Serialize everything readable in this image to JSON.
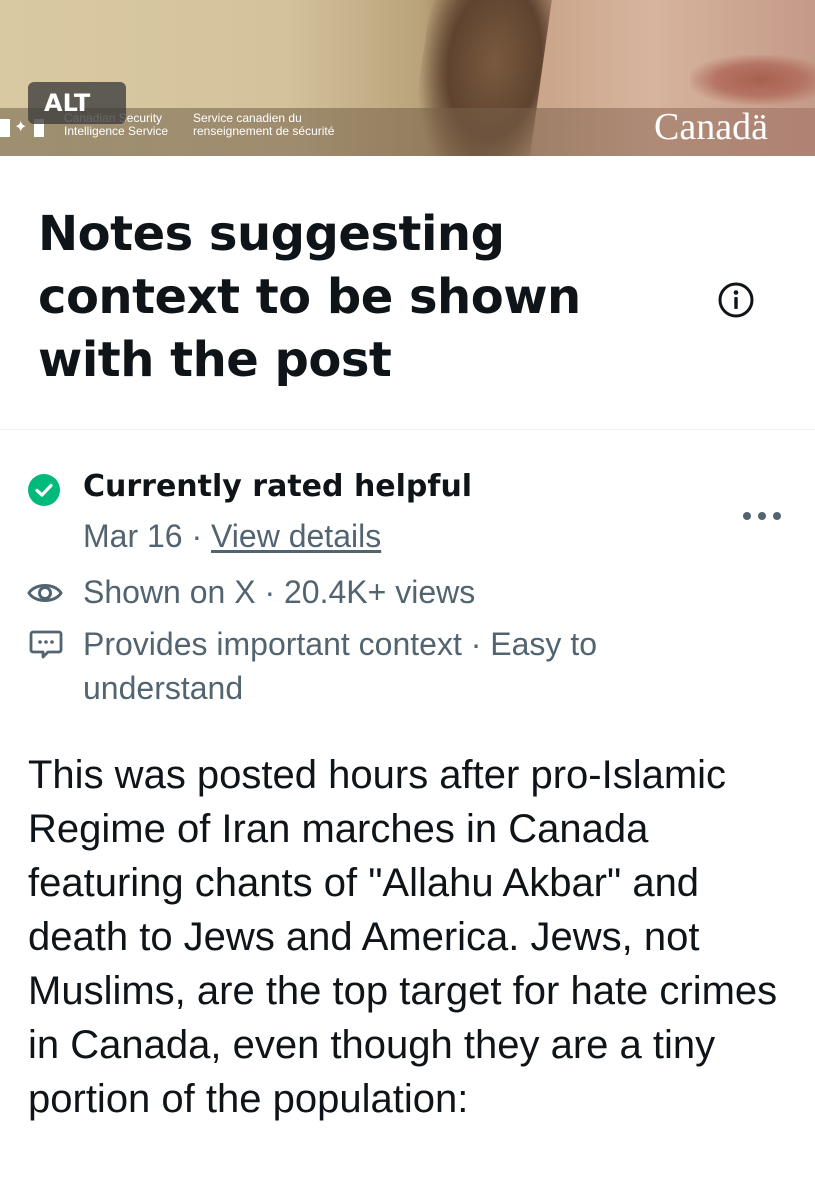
{
  "banner": {
    "alt_badge": "ALT",
    "agency_en_line1": "Canadian Security",
    "agency_en_line2": "Intelligence Service",
    "agency_fr_line1": "Service canadien du",
    "agency_fr_line2": "renseignement de sécurité",
    "wordmark": "Canadä"
  },
  "header": {
    "title": "Notes suggesting context to be shown with the post",
    "info_icon": "info-icon"
  },
  "note": {
    "status": "Currently rated helpful",
    "date": "Mar 16",
    "separator": " · ",
    "details_link": "View details",
    "shown_on": "Shown on X · 20.4K+ views",
    "reasons": "Provides important context · Easy to understand",
    "body": "This was posted hours after pro-Islamic Regime of Iran marches in Canada featuring chants of \"Allahu Akbar\" and death to Jews and America. Jews, not Muslims, are the top target for hate crimes in Canada, even though they are a tiny portion of the population:",
    "status_color": "#00ba7c"
  }
}
